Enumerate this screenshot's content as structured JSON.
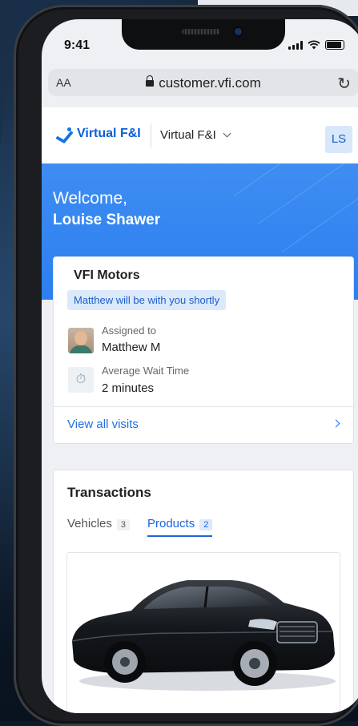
{
  "status_bar": {
    "time": "9:41"
  },
  "browser": {
    "text_size": "AA",
    "url": "customer.vfi.com"
  },
  "header": {
    "logo_text": "Virtual F&I",
    "org_name": "Virtual F&I",
    "user_initials": "LS"
  },
  "welcome": {
    "greeting": "Welcome,",
    "user_name": "Louise Shawer"
  },
  "visit_card": {
    "dealer": "VFI Motors",
    "status_chip": "Matthew will be with you shortly",
    "assigned_label": "Assigned to",
    "assigned_value": "Matthew M",
    "wait_label": "Average Wait Time",
    "wait_value": "2 minutes",
    "view_all": "View all visits"
  },
  "transactions": {
    "title": "Transactions",
    "tabs": [
      {
        "label": "Vehicles",
        "count": "3",
        "active": false
      },
      {
        "label": "Products",
        "count": "2",
        "active": true
      }
    ]
  },
  "colors": {
    "brand_blue": "#2d7ff0",
    "link_blue": "#1f6fe0",
    "chip_bg": "#dbe9fb"
  }
}
